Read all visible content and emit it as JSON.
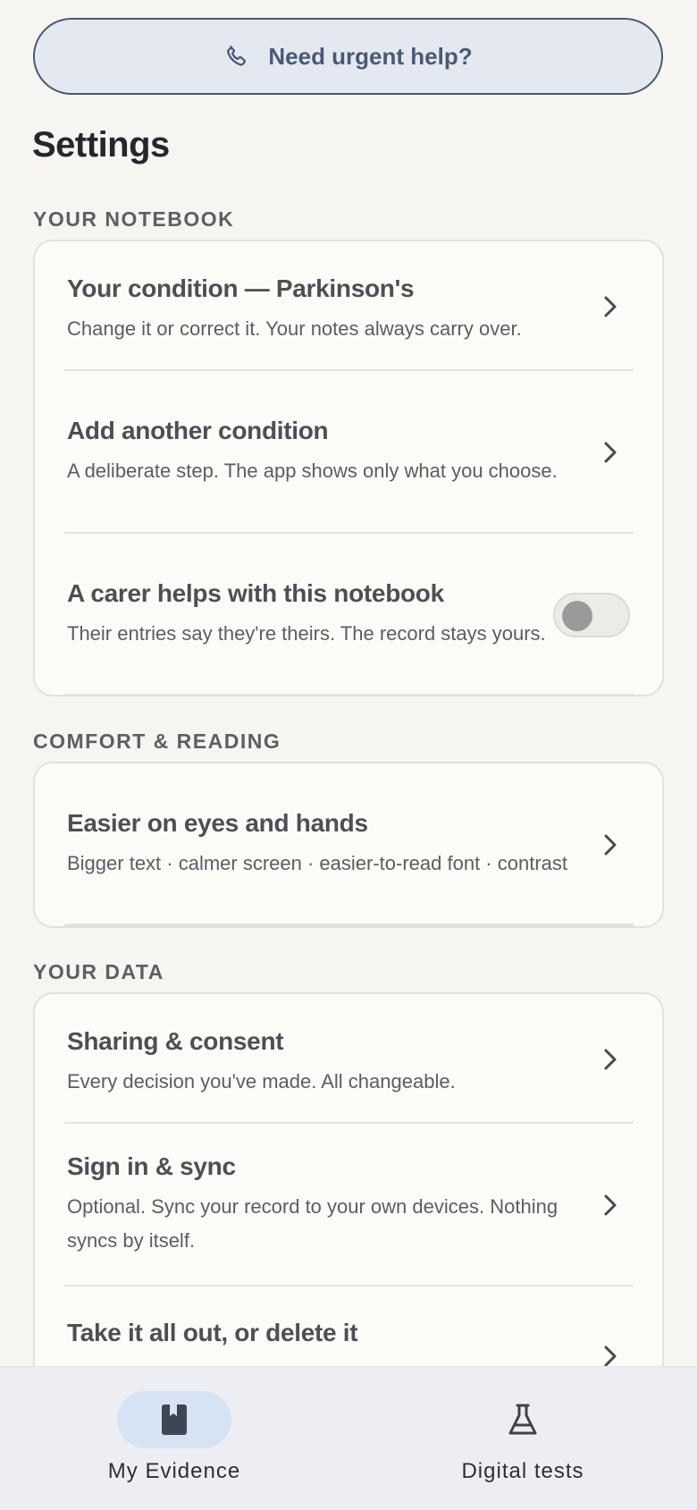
{
  "urgent_help": {
    "label": "Need urgent help?",
    "icon": "phone-icon"
  },
  "page_title": "Settings",
  "sections": {
    "notebook": {
      "label": "YOUR NOTEBOOK",
      "rows": [
        {
          "title": "Your condition — Parkinson's",
          "subtitle": "Change it or correct it. Your notes always carry over."
        },
        {
          "title": "Add another condition",
          "subtitle": "A deliberate step. The app shows only what you choose."
        },
        {
          "title": "A carer helps with this notebook",
          "subtitle": "Their entries say they're theirs. The record stays yours.",
          "toggle_on": false
        }
      ]
    },
    "comfort": {
      "label": "COMFORT & READING",
      "rows": [
        {
          "title": "Easier on eyes and hands",
          "subtitle": "Bigger text · calmer screen · easier-to-read font · contrast"
        }
      ]
    },
    "data": {
      "label": "YOUR DATA",
      "rows": [
        {
          "title": "Sharing & consent",
          "subtitle": "Every decision you've made. All changeable."
        },
        {
          "title": "Sign in & sync",
          "subtitle": "Optional. Sync your record to your own devices. Nothing syncs by itself."
        },
        {
          "title": "Take it all out, or delete it",
          "subtitle": ""
        }
      ]
    }
  },
  "bottom_nav": {
    "items": [
      {
        "label": "My Evidence",
        "icon": "book-icon",
        "active": true
      },
      {
        "label": "Digital tests",
        "icon": "flask-icon",
        "active": false
      }
    ]
  },
  "colors": {
    "accent": "#4a5a72",
    "active_pill": "#d6e3f4",
    "page_bg": "#f6f5f2"
  }
}
